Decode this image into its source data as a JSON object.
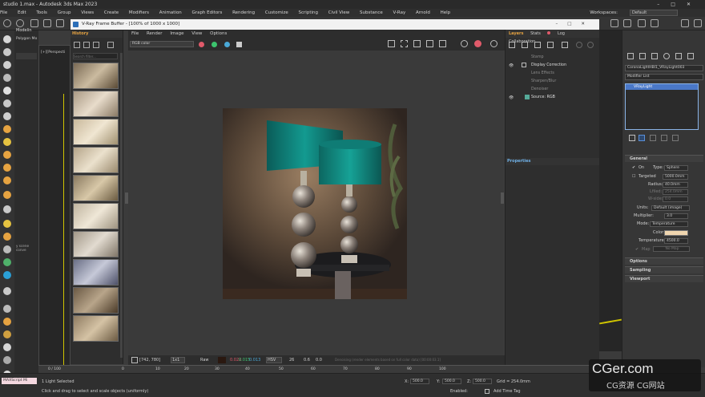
{
  "title": "studio 1.max - Autodesk 3ds Max 2023",
  "menubar": {
    "items": [
      "File",
      "Edit",
      "Tools",
      "Group",
      "Views",
      "Create",
      "Modifiers",
      "Animation",
      "Graph Editors",
      "Rendering",
      "Customize",
      "Scripting",
      "Civil View",
      "Substance",
      "V-Ray",
      "Arnold",
      "Help"
    ],
    "workspaces_label": "Workspaces:",
    "workspace_value": "Default"
  },
  "left_panel": {
    "tab_modeling": "Modelin",
    "tab_polygon": "Polygon Mo",
    "viewport_label": "[+][Perspecti",
    "scene_label": "y scene conve"
  },
  "history": {
    "title": "History",
    "search_placeholder": "Search filter..."
  },
  "vfb": {
    "window_title": "V-Ray Frame Buffer - [100% of 1000 x 1000]",
    "menu": [
      "File",
      "Render",
      "Image",
      "View",
      "Options"
    ],
    "channel": "RGB color",
    "status": {
      "coords": "[742, 780]",
      "zoom": "1x1",
      "mode": "Raw",
      "r": "0.022",
      "g": "0.015",
      "b": "0.013",
      "space": "HSV",
      "h": "26",
      "s": "0.6",
      "v": "0.0",
      "message": "Denoising (render elements based on full color data) [00:00:03.1]"
    }
  },
  "layers": {
    "tabs": [
      "Layers",
      "Stats",
      "Log",
      "Collaboration"
    ],
    "items": [
      "Stamp",
      "Display Correction",
      "Lens Effects",
      "Sharpen/Blur",
      "Denoiser",
      "Source: RGB"
    ],
    "properties_title": "Properties"
  },
  "command_panel": {
    "object_name": "CoronaLightHBl1_VRayLight003",
    "modifier_list": "Modifier List",
    "stack_item": "VRayLight",
    "general": "General",
    "on_label": "On",
    "type_label": "Type:",
    "type_value": "Sphere",
    "targeted_label": "Targeted",
    "length": "5000.0mm",
    "radius_label": "Radius:",
    "radius_value": "40.0mm",
    "u_label": "Lfiled:",
    "u_value": "254.0mm",
    "w_label": "W-side:",
    "w_value": "0.0",
    "units_label": "Units:",
    "units_value": "Default (image)",
    "multiplier_label": "Multiplier:",
    "multiplier_value": "3.0",
    "mode_label": "Mode:",
    "mode_value": "Temperature",
    "color_label": "Color:",
    "temperature_label": "Temperature:",
    "temperature_value": "4500.0",
    "map_label": "Map",
    "no_map": "No Map",
    "options": "Options",
    "sampling": "Sampling",
    "viewport": "Viewport"
  },
  "timeline": {
    "frame_counter": "0 / 100",
    "ticks": [
      "0",
      "10",
      "20",
      "30",
      "40",
      "50",
      "60",
      "70",
      "80",
      "90",
      "100"
    ]
  },
  "status": {
    "maxscript": "MAXScript Mi",
    "selection": "1 Light Selected",
    "hint": "Click and drag to select and scale objects (uniformly)",
    "x_label": "X:",
    "x_value": "500.0",
    "y_label": "Y:",
    "y_value": "500.0",
    "z_label": "Z:",
    "z_value": "500.0",
    "grid": "Grid = 254.0mm",
    "enabled": "Enabled:",
    "add_time_tag": "Add Time Tag"
  },
  "watermark": {
    "line1": "CGer.com",
    "line2": "CG资源 CG网站"
  },
  "colors": {
    "accent_orange": "#e6a341",
    "accent_blue": "#6fb0e6",
    "teal_shade": "#0f6e6a"
  }
}
